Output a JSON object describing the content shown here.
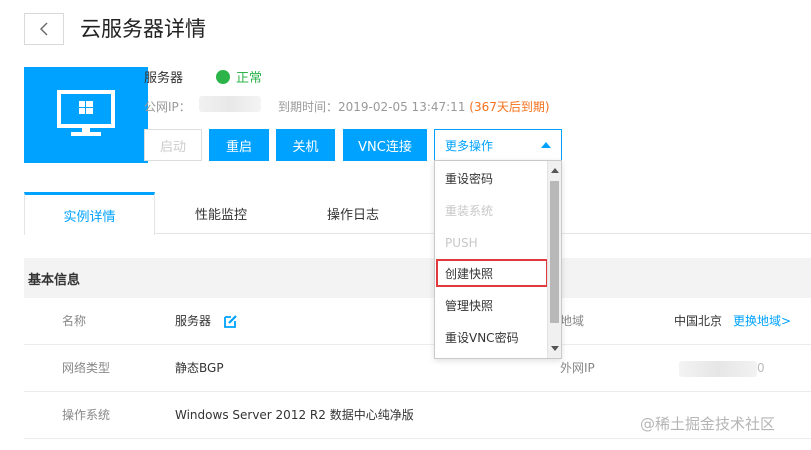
{
  "header": {
    "title": "云服务器详情",
    "back_icon": "chevron-left-icon"
  },
  "server": {
    "icon": "windows-monitor-icon",
    "name": "服务器",
    "status": "正常",
    "status_color": "#2cb44a",
    "ip_label": "公网IP：",
    "expire_label": "到期时间：2019-02-05 13:47:11",
    "expire_remaining": "(367天后到期)"
  },
  "actions": {
    "start": "启动",
    "restart": "重启",
    "shutdown": "关机",
    "vnc": "VNC连接",
    "more": "更多操作"
  },
  "more_menu": {
    "items": [
      {
        "label": "重设密码",
        "disabled": false
      },
      {
        "label": "重装系统",
        "disabled": true
      },
      {
        "label": "PUSH",
        "disabled": true
      },
      {
        "label": "创建快照",
        "disabled": false,
        "highlighted": true
      },
      {
        "label": "管理快照",
        "disabled": false
      },
      {
        "label": "重设VNC密码",
        "disabled": false
      }
    ]
  },
  "tabs": [
    {
      "label": "实例详情",
      "active": true
    },
    {
      "label": "性能监控",
      "active": false
    },
    {
      "label": "操作日志",
      "active": false
    }
  ],
  "basic_info": {
    "title": "基本信息",
    "rows": [
      {
        "label": "名称",
        "value": "服务器",
        "label2": "地域",
        "value2": "中国北京",
        "link": "更换地域>"
      },
      {
        "label": "网络类型",
        "value": "静态BGP",
        "label2": "外网IP",
        "value2_tail": "0"
      },
      {
        "label": "操作系统",
        "value": "Windows Server 2012 R2 数据中心纯净版"
      }
    ]
  },
  "watermark": "@稀土掘金技术社区",
  "colors": {
    "accent": "#00a2ff",
    "warning": "#f5701b",
    "highlight_border": "#e0393e"
  }
}
